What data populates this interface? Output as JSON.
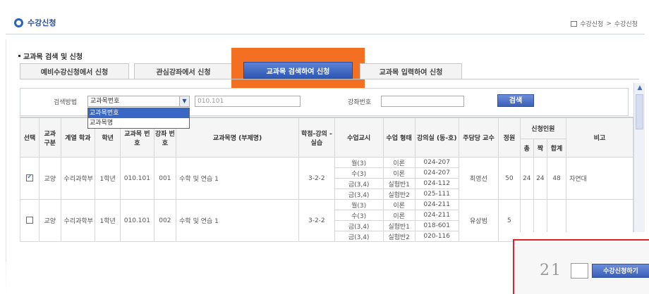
{
  "header": {
    "title": "수강신청",
    "breadcrumb": [
      "수강신청",
      ">",
      "수강신청"
    ]
  },
  "section_title": "교과목 검색 및 신청",
  "tabs": [
    {
      "label": "예비수강신청에서 신청",
      "active": false
    },
    {
      "label": "관심강좌에서 신청",
      "active": false
    },
    {
      "label": "교과목 검색하여 신청",
      "active": true
    },
    {
      "label": "교과목 입력하여 신청",
      "active": false
    }
  ],
  "search": {
    "method_label": "검색방법",
    "method_selected": "교과목번호",
    "method_options": [
      "교과목번호",
      "교과목명"
    ],
    "course_value": "010.101",
    "lecture_label": "강좌번호",
    "lecture_value": "",
    "search_button": "검색"
  },
  "table": {
    "headers": {
      "select": "선택",
      "category": "교과 구분",
      "dept": "계열 학과",
      "year": "학년",
      "course_no": "교과목 번호",
      "lecture_no": "강좌 번호",
      "course_name": "교과목명 (부제명)",
      "credits": "학점-강의 -실습",
      "time": "수업교시",
      "type": "수업 형태",
      "room": "강의실 (동-호)",
      "professor": "주담당 교수",
      "capacity": "정원",
      "enrolled": "신청인원",
      "enrolled_sub": [
        "총",
        "짝",
        "합계"
      ],
      "remark": "비고"
    },
    "rows": [
      {
        "checked": true,
        "category": "교양",
        "dept": "수리과학부",
        "year": "1학년",
        "course_no": "010.101",
        "lecture_no": "001",
        "course_name": "수학 및 연습 1",
        "credits": "3-2-2",
        "sessions": [
          {
            "time": "월(3)",
            "type": "이론",
            "room": "024-207"
          },
          {
            "time": "수(3)",
            "type": "이론",
            "room": "024-207"
          },
          {
            "time": "금(3,4)",
            "type": "실험반1",
            "room": "024-112"
          },
          {
            "time": "금(3,4)",
            "type": "실험반2",
            "room": "025-111"
          }
        ],
        "professor": "최영선",
        "capacity": "50",
        "enrolled": [
          "24",
          "24",
          "48"
        ],
        "remark": "자연대"
      },
      {
        "checked": false,
        "category": "교양",
        "dept": "수리과학부",
        "year": "1학년",
        "course_no": "010.101",
        "lecture_no": "002",
        "course_name": "수학 및 연습 1",
        "credits": "3-2-2",
        "sessions": [
          {
            "time": "월(3)",
            "type": "이론",
            "room": "024-211"
          },
          {
            "time": "수(3)",
            "type": "이론",
            "room": "024-211"
          },
          {
            "time": "금(3,4)",
            "type": "실험반1",
            "room": "018-601"
          },
          {
            "time": "금(3,4)",
            "type": "실험반2",
            "room": "020-116"
          }
        ],
        "professor": "유상범",
        "capacity": "5",
        "enrolled": [
          "",
          "",
          ""
        ],
        "remark": ""
      }
    ]
  },
  "inset": {
    "captcha": "21",
    "apply_button": "수강신청하기"
  },
  "colors": {
    "accent": "#2f57b4",
    "highlight_frame": "#f36f21",
    "inset_border": "#e0202a"
  }
}
